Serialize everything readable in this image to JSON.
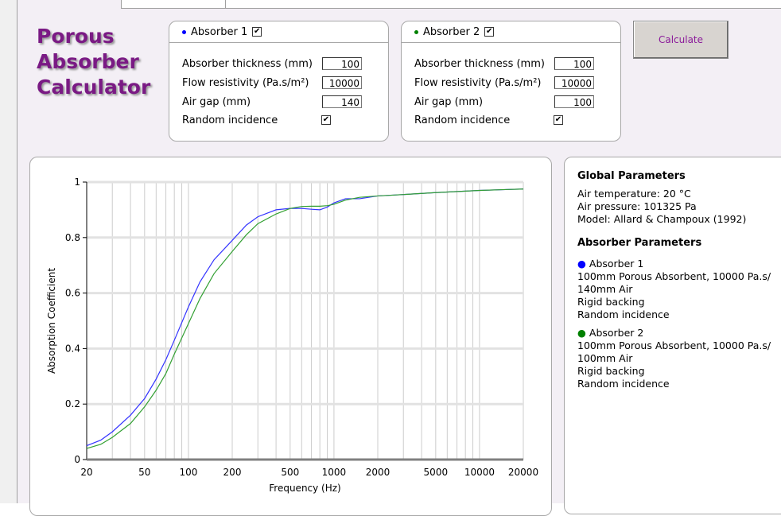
{
  "app_title": [
    "Porous",
    "Absorber",
    "Calculator"
  ],
  "calculate_label": "Calculate",
  "absorbers": [
    {
      "name": "Absorber 1",
      "color": "#0000ff",
      "enabled": true,
      "thickness_label": "Absorber thickness (mm)",
      "thickness": "100",
      "flow_label": "Flow resistivity (Pa.s/m²)",
      "flow": "10000",
      "airgap_label": "Air gap (mm)",
      "airgap": "140",
      "random_label": "Random incidence",
      "random": true
    },
    {
      "name": "Absorber 2",
      "color": "#008000",
      "enabled": true,
      "thickness_label": "Absorber thickness (mm)",
      "thickness": "100",
      "flow_label": "Flow resistivity (Pa.s/m²)",
      "flow": "10000",
      "airgap_label": "Air gap (mm)",
      "airgap": "100",
      "random_label": "Random incidence",
      "random": true
    }
  ],
  "info": {
    "global_title": "Global Parameters",
    "global_lines": [
      "Air temperature: 20 °C",
      "Air pressure: 101325 Pa",
      "Model: Allard & Champoux (1992)"
    ],
    "absorber_title": "Absorber Parameters",
    "abs1": {
      "name": "Absorber 1",
      "lines": [
        "100mm Porous Absorbent, 10000 Pa.s/",
        "140mm Air",
        "Rigid backing",
        "Random incidence"
      ]
    },
    "abs2": {
      "name": "Absorber 2",
      "lines": [
        "100mm Porous Absorbent, 10000 Pa.s/",
        "100mm Air",
        "Rigid backing",
        "Random incidence"
      ]
    }
  },
  "chart_data": {
    "type": "line",
    "xlabel": "Frequency (Hz)",
    "ylabel": "Absorption Coefficient",
    "xscale": "log",
    "xlim": [
      20,
      20000
    ],
    "ylim": [
      0,
      1
    ],
    "xticks": [
      20,
      50,
      100,
      200,
      500,
      1000,
      2000,
      5000,
      10000,
      20000
    ],
    "xtick_labels": [
      "20",
      "50",
      "100",
      "200",
      "500",
      "1000",
      "2000",
      "5000",
      "10000",
      "20000"
    ],
    "yticks": [
      0,
      0.2,
      0.4,
      0.6,
      0.8,
      1
    ],
    "ytick_labels": [
      "0",
      "0.2",
      "0.4",
      "0.6",
      "0.8",
      "1"
    ],
    "series": [
      {
        "name": "Absorber 1",
        "color": "#3333ff",
        "x": [
          20,
          25,
          30,
          40,
          50,
          60,
          70,
          80,
          100,
          120,
          150,
          200,
          250,
          300,
          400,
          500,
          600,
          700,
          800,
          900,
          1000,
          1200,
          1500,
          2000,
          3000,
          5000,
          10000,
          20000
        ],
        "y": [
          0.05,
          0.07,
          0.1,
          0.16,
          0.22,
          0.29,
          0.36,
          0.43,
          0.55,
          0.64,
          0.72,
          0.79,
          0.845,
          0.875,
          0.9,
          0.905,
          0.905,
          0.902,
          0.9,
          0.91,
          0.925,
          0.94,
          0.94,
          0.95,
          0.955,
          0.962,
          0.97,
          0.975
        ]
      },
      {
        "name": "Absorber 2",
        "color": "#33a033",
        "x": [
          20,
          25,
          30,
          40,
          50,
          60,
          70,
          80,
          100,
          120,
          150,
          200,
          250,
          300,
          400,
          500,
          600,
          700,
          800,
          900,
          1000,
          1200,
          1500,
          2000,
          3000,
          5000,
          10000,
          20000
        ],
        "y": [
          0.04,
          0.055,
          0.08,
          0.13,
          0.19,
          0.25,
          0.31,
          0.38,
          0.49,
          0.58,
          0.67,
          0.75,
          0.81,
          0.85,
          0.885,
          0.905,
          0.912,
          0.913,
          0.913,
          0.915,
          0.92,
          0.935,
          0.945,
          0.95,
          0.955,
          0.962,
          0.97,
          0.975
        ]
      }
    ]
  }
}
